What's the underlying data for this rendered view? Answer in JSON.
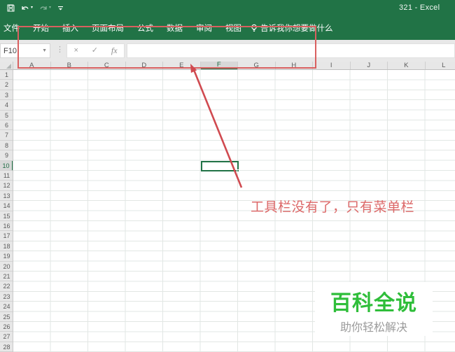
{
  "titlebar": {
    "title": "321 - Excel"
  },
  "menubar": {
    "tabs": [
      "文件",
      "开始",
      "插入",
      "页面布局",
      "公式",
      "数据",
      "审阅",
      "视图"
    ],
    "tell_me_label": "告诉我你想要做什么"
  },
  "formula_bar": {
    "name_box_value": "F10",
    "cancel_glyph": "×",
    "enter_glyph": "✓",
    "function_glyph": "fx",
    "formula_value": ""
  },
  "sheet": {
    "column_headers": [
      "A",
      "B",
      "C",
      "D",
      "E",
      "F",
      "G",
      "H",
      "I",
      "J",
      "K",
      "L"
    ],
    "row_headers": [
      "1",
      "2",
      "3",
      "4",
      "5",
      "6",
      "7",
      "8",
      "9",
      "10",
      "11",
      "12",
      "13",
      "14",
      "15",
      "16",
      "17",
      "18",
      "19",
      "20",
      "21",
      "22",
      "23",
      "24",
      "25",
      "26",
      "27",
      "28"
    ],
    "selected_cell": "F10",
    "selected_column": "F",
    "selected_row": "10"
  },
  "annotations": {
    "callout_text": "工具栏没有了，只有菜单栏",
    "red_color": "#d96060"
  },
  "watermark": {
    "title": "百科全说",
    "subtitle": "助你轻松解决",
    "title_color": "#2fbe3a"
  },
  "colors": {
    "excel_green": "#217346",
    "selection_green": "#217346"
  }
}
